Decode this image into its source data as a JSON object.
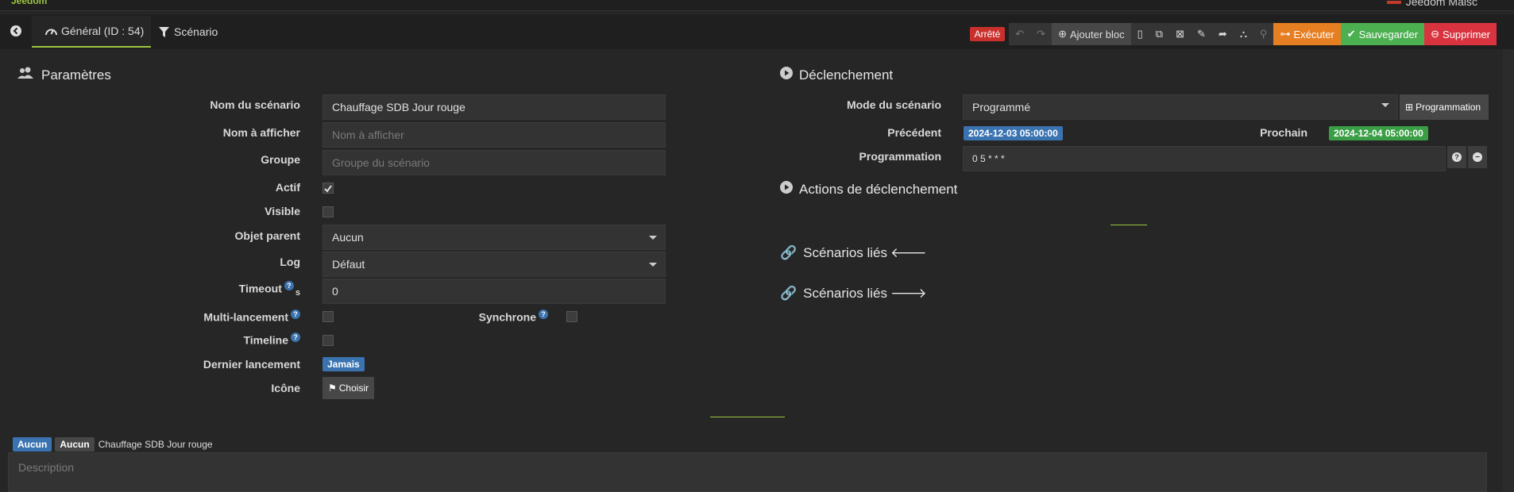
{
  "window": {
    "user_label": "Jeedom Maisc",
    "logo_label": "Jeedom"
  },
  "tabs": [
    {
      "label": "Général (ID : 54)",
      "icon": "dashboard-icon",
      "active": true
    },
    {
      "label": "Scénario",
      "icon": "filter-icon",
      "active": false
    }
  ],
  "toolbar": {
    "status": "Arrêté",
    "add_block": "Ajouter bloc",
    "execute": "Exécuter",
    "save": "Sauvegarder",
    "delete": "Supprimer"
  },
  "parametres": {
    "title": "Paramètres",
    "nom_label": "Nom du scénario",
    "nom_value": "Chauffage SDB Jour rouge",
    "afficher_label": "Nom à afficher",
    "afficher_placeholder": "Nom à afficher",
    "groupe_label": "Groupe",
    "groupe_placeholder": "Groupe du scénario",
    "actif_label": "Actif",
    "actif_checked": true,
    "visible_label": "Visible",
    "visible_checked": false,
    "objet_label": "Objet parent",
    "objet_value": "Aucun",
    "log_label": "Log",
    "log_value": "Défaut",
    "timeout_label": "Timeout",
    "timeout_unit": "s",
    "timeout_value": "0",
    "multi_label": "Multi-lancement",
    "synchrone_label": "Synchrone",
    "timeline_label": "Timeline",
    "dernier_label": "Dernier lancement",
    "dernier_value": "Jamais",
    "icone_label": "Icône",
    "icone_button": "Choisir"
  },
  "declenchement": {
    "title": "Déclenchement",
    "mode_label": "Mode du scénario",
    "mode_value": "Programmé",
    "programmation_button": "Programmation",
    "precedent_label": "Précédent",
    "precedent_value": "2024-12-03 05:00:00",
    "prochain_label": "Prochain",
    "prochain_value": "2024-12-04 05:00:00",
    "prog_label": "Programmation",
    "prog_value": "0 5 * * *"
  },
  "actions_title": "Actions de déclenchement",
  "lies_in_title": "Scénarios liés",
  "lies_out_title": "Scénarios liés",
  "footer": {
    "badge1": "Aucun",
    "badge2": "Aucun",
    "scenario_name": "Chauffage SDB Jour rouge",
    "description_placeholder": "Description"
  },
  "colors": {
    "accent": "#9bc53d",
    "blue": "#3a73b0",
    "green": "#3a9e45",
    "red": "#c9302c",
    "orange": "#e67e22"
  }
}
